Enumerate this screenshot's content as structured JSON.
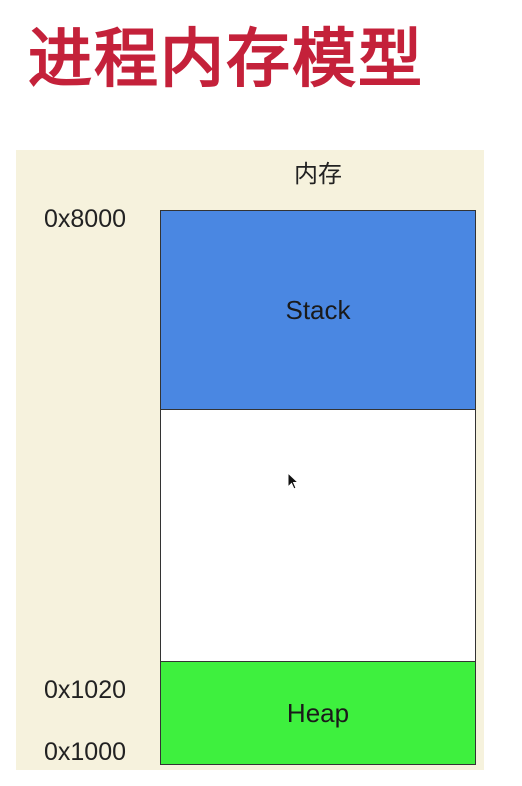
{
  "title": "进程内存模型",
  "memory": {
    "label": "内存",
    "regions": {
      "stack": "Stack",
      "free": "",
      "heap": "Heap"
    },
    "addresses": {
      "top": "0x8000",
      "heap_top": "0x1020",
      "bottom": "0x1000"
    }
  },
  "colors": {
    "title": "#c4213a",
    "panel": "#f6f2dd",
    "stack": "#4a87e2",
    "heap": "#3ef03e",
    "free": "#ffffff"
  },
  "icons": {
    "cursor": "mouse-pointer-icon"
  }
}
